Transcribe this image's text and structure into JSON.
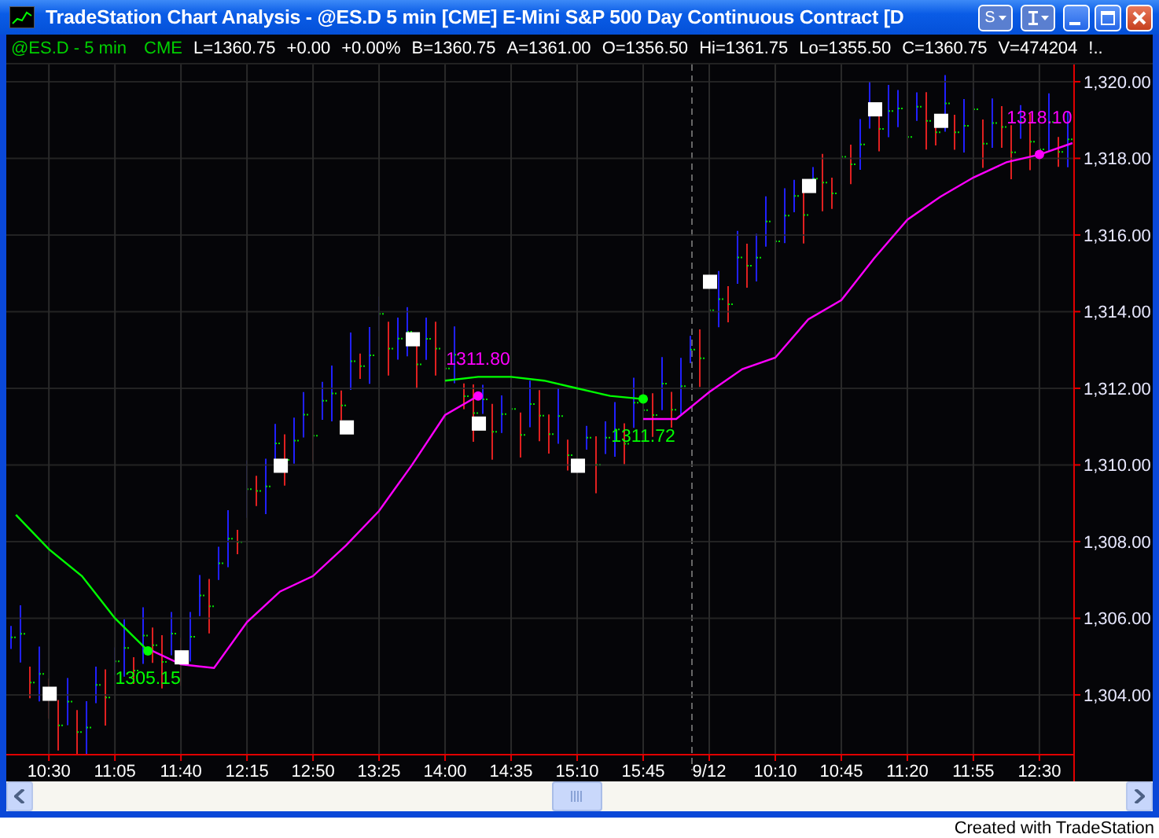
{
  "window": {
    "title": "TradeStation Chart Analysis - @ES.D  5 min  [CME] E-Mini S&P 500 Day Continuous Contract [D",
    "menu_button": "S"
  },
  "info_bar": {
    "symbol": "@ES.D - 5 min",
    "exchange": "CME",
    "fields": [
      "L=1360.75",
      "+0.00",
      "+0.00%",
      "B=1360.75",
      "A=1361.00",
      "O=1356.50",
      "Hi=1361.75",
      "Lo=1355.50",
      "C=1360.75",
      "V=474204",
      "!.."
    ]
  },
  "chart": {
    "chart_data": {
      "type": "line",
      "categories": [
        null,
        "10:30",
        null,
        "11:05",
        null,
        "11:40",
        null,
        "12:15",
        null,
        "12:50",
        null,
        "13:25",
        null,
        "14:00",
        null,
        "14:35",
        null,
        "15:10",
        null,
        "15:45",
        null,
        "9/12",
        null,
        "10:10",
        null,
        "10:45",
        null,
        "11:20",
        null,
        "11:55",
        null,
        "12:30",
        null
      ],
      "series": [
        {
          "color": "#00ff00",
          "values": [
            1308.7,
            1307.8,
            1307.1,
            1306.0,
            1305.15,
            null,
            null,
            null,
            null,
            null,
            null,
            null,
            null,
            1312.2,
            1312.3,
            1312.3,
            1312.2,
            1312.0,
            1311.8,
            1311.72,
            null,
            null,
            null,
            null,
            null,
            null,
            null,
            null,
            null,
            null,
            null,
            null,
            null
          ]
        },
        {
          "color": "#ff00ff",
          "values": [
            null,
            null,
            null,
            null,
            1305.2,
            1304.8,
            1304.7,
            1305.9,
            1306.7,
            1307.1,
            1307.9,
            1308.8,
            1310.0,
            1311.3,
            1311.8,
            null,
            null,
            null,
            null,
            1311.2,
            1311.2,
            1311.9,
            1312.5,
            1312.8,
            1313.8,
            1314.3,
            1315.4,
            1316.4,
            1317.0,
            1317.5,
            1317.9,
            1318.1,
            1318.4
          ]
        },
        {
          "color": "#ffffff",
          "type": "scatter",
          "marker": "square",
          "values": [
            null,
            1304.05,
            null,
            null,
            null,
            1305.0,
            null,
            null,
            1310.0,
            null,
            1311.0,
            null,
            1313.3,
            null,
            1311.1,
            null,
            null,
            1310.0,
            null,
            null,
            null,
            1314.8,
            null,
            null,
            1317.3,
            null,
            1319.3,
            null,
            1319.0,
            null,
            null,
            null,
            null
          ]
        },
        {
          "color": "#00ff00",
          "type": "scatter",
          "marker": "circle",
          "values": [
            null,
            null,
            null,
            null,
            1305.15,
            null,
            null,
            null,
            null,
            null,
            null,
            null,
            null,
            null,
            null,
            null,
            null,
            null,
            null,
            1311.72,
            null,
            null,
            null,
            null,
            null,
            null,
            null,
            null,
            null,
            null,
            null,
            null,
            null
          ]
        },
        {
          "color": "#ff00ff",
          "type": "scatter",
          "marker": "circle",
          "values": [
            null,
            null,
            null,
            null,
            null,
            null,
            null,
            null,
            null,
            null,
            null,
            null,
            null,
            null,
            1311.8,
            null,
            null,
            null,
            null,
            null,
            null,
            null,
            null,
            null,
            null,
            null,
            null,
            null,
            null,
            null,
            null,
            1318.1,
            null
          ]
        }
      ],
      "grid": true,
      "ylim": [
        1302.44,
        1320.45
      ],
      "yticks": [
        {
          "value": 1304,
          "label": "1,304.00"
        },
        {
          "value": 1306,
          "label": "1,306.00"
        },
        {
          "value": 1308,
          "label": "1,308.00"
        },
        {
          "value": 1310,
          "label": "1,310.00"
        },
        {
          "value": 1312,
          "label": "1,312.00"
        },
        {
          "value": 1314,
          "label": "1,314.00"
        },
        {
          "value": 1316,
          "label": "1,316.00"
        },
        {
          "value": 1318,
          "label": "1,318.00"
        },
        {
          "value": 1320,
          "label": "1,320.00"
        }
      ],
      "annotations": [
        "1305.15",
        "1311.80",
        "1311.72",
        "1318.10"
      ]
    }
  },
  "footer": {
    "text": "Created with TradeStation"
  }
}
